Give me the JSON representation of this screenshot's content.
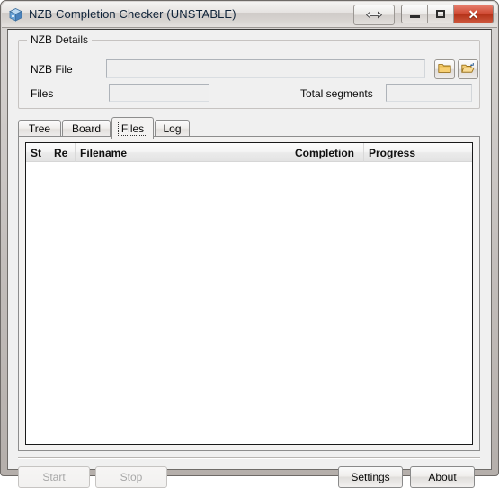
{
  "window": {
    "title": "NZB Completion Checker (UNSTABLE)",
    "app_icon": "blue-cube-icon",
    "controls": {
      "resize": "resize-arrow-icon",
      "minimize": "minimize-icon",
      "maximize": "maximize-icon",
      "close": "✕"
    },
    "accent_close_color": "#c0391d",
    "title_text_color": "#10243a"
  },
  "nzb_details": {
    "legend": "NZB Details",
    "nzb_file": {
      "label": "NZB File",
      "value": "",
      "placeholder": ""
    },
    "files": {
      "label": "Files",
      "value": "",
      "placeholder": ""
    },
    "total_segments": {
      "label": "Total segments",
      "value": "",
      "placeholder": ""
    },
    "browse_buttons": [
      {
        "name": "browse-folder-button",
        "icon": "folder-closed-icon"
      },
      {
        "name": "open-folder-button",
        "icon": "folder-open-icon"
      }
    ]
  },
  "tabs": {
    "selected": "Files",
    "items": [
      {
        "label": "Tree"
      },
      {
        "label": "Board"
      },
      {
        "label": "Files"
      },
      {
        "label": "Log"
      }
    ]
  },
  "files_list": {
    "columns": [
      {
        "label": "St"
      },
      {
        "label": "Re"
      },
      {
        "label": "Filename"
      },
      {
        "label": "Completion"
      },
      {
        "label": "Progress"
      }
    ],
    "rows": []
  },
  "bottom_bar": {
    "start": {
      "label": "Start",
      "enabled": false
    },
    "stop": {
      "label": "Stop",
      "enabled": false
    },
    "settings": {
      "label": "Settings",
      "enabled": true
    },
    "about": {
      "label": "About",
      "enabled": true
    }
  }
}
